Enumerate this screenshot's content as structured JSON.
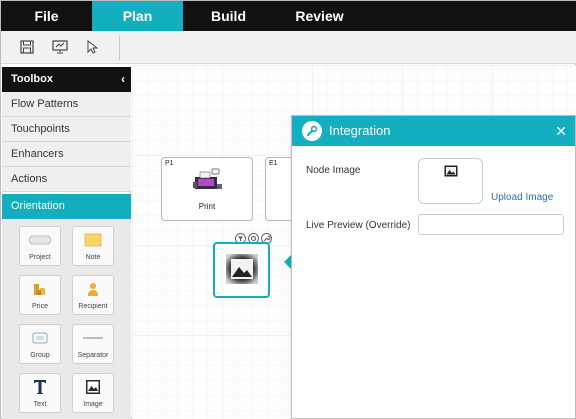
{
  "menu": {
    "tabs": [
      {
        "label": "File",
        "active": false
      },
      {
        "label": "Plan",
        "active": true
      },
      {
        "label": "Build",
        "active": false
      },
      {
        "label": "Review",
        "active": false
      }
    ]
  },
  "toolbar": {
    "buttons": [
      "save-icon",
      "presentation-icon",
      "pointer-icon"
    ]
  },
  "sidebar": {
    "header": "Toolbox",
    "items": [
      {
        "label": "Flow Patterns"
      },
      {
        "label": "Touchpoints"
      },
      {
        "label": "Enhancers"
      },
      {
        "label": "Actions"
      },
      {
        "label": "Orientation",
        "active": true
      }
    ],
    "tiles": [
      {
        "label": "Project",
        "icon": "project-icon"
      },
      {
        "label": "Note",
        "icon": "note-icon"
      },
      {
        "label": "Price",
        "icon": "price-icon"
      },
      {
        "label": "Recipient",
        "icon": "recipient-icon"
      },
      {
        "label": "Group",
        "icon": "group-icon"
      },
      {
        "label": "Separator",
        "icon": "separator-icon"
      },
      {
        "label": "Text",
        "icon": "text-icon"
      },
      {
        "label": "Image",
        "icon": "image-icon"
      }
    ]
  },
  "canvas": {
    "nodes": [
      {
        "tag": "P1",
        "name": "Print",
        "icon": "printer-icon"
      },
      {
        "tag": "E1",
        "name": "",
        "icon": ""
      }
    ],
    "selected_node": {
      "icon": "image-icon",
      "actions": [
        "filter-icon",
        "settings-icon",
        "wrench-icon"
      ]
    }
  },
  "panel": {
    "title": "Integration",
    "node_image_label": "Node Image",
    "upload_label": "Upload Image",
    "live_preview_label": "Live Preview (Override)",
    "live_preview_value": ""
  },
  "colors": {
    "accent": "#13aebf",
    "menubar": "#111111",
    "link": "#2a72b5"
  }
}
